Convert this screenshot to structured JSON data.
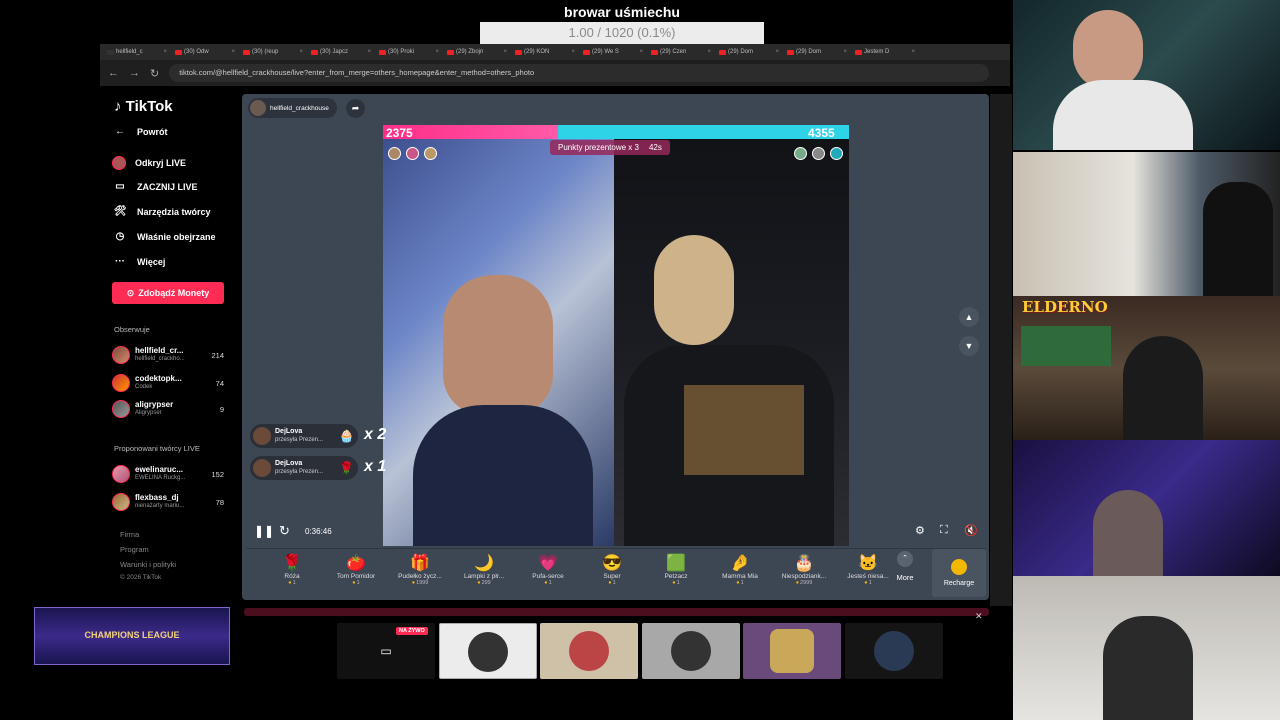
{
  "overlay": {
    "title": "browar uśmiechu",
    "progress_text": "1.00 / 1020 (0.1%)"
  },
  "browser": {
    "tabs": [
      "hellfield_c",
      "(30) Odw",
      "(30) (reup",
      "(30) Japcz",
      "(30) Proki",
      "(29) Zbojn",
      "(29) KON",
      "(29) We S",
      "(29) Czen",
      "(29) Dom",
      "(29) Dom",
      "Jestem D"
    ],
    "url": "tiktok.com/@hellfield_crackhouse/live?enter_from_merge=others_homepage&enter_method=others_photo"
  },
  "sidebar": {
    "logo": "TikTok",
    "back": "Powrót",
    "nav": [
      "Odkryj LIVE",
      "ZACZNIJ LIVE",
      "Narzędzia twórcy",
      "Właśnie obejrzane",
      "Więcej"
    ],
    "earn_button": "Zdobądź Monety",
    "following_title": "Obserwuje",
    "following": [
      {
        "name": "hellfield_cr...",
        "sub": "hellfield_crackho...",
        "count": "214"
      },
      {
        "name": "codektopk...",
        "sub": "Codek",
        "count": "74"
      },
      {
        "name": "aligrypser",
        "sub": "Aligrypser",
        "count": "9"
      }
    ],
    "suggested_title": "Proponowani twórcy LIVE",
    "suggested": [
      {
        "name": "ewelinaruc...",
        "sub": "EWELINA Ruckg...",
        "count": "152"
      },
      {
        "name": "flexbass_dj",
        "sub": "nienażarty mariu...",
        "count": "78"
      }
    ],
    "footer": [
      "Firma",
      "Program",
      "Warunki i polityki",
      "© 2026 TikTok"
    ]
  },
  "player": {
    "host": "hellfield_crackhouse",
    "score_left": "2375",
    "score_right": "4355",
    "battle_label": "Punkty prezentowe x 3",
    "battle_timer": "42s",
    "toasts": [
      {
        "user": "DejLova",
        "text": "przesyła Prezen...",
        "mult": "x 2"
      },
      {
        "user": "DejLova",
        "text": "przesyła Prezen...",
        "mult": "x 1"
      }
    ],
    "time": "0:36:46"
  },
  "gifts": [
    {
      "name": "Róża",
      "price": "1",
      "icon": "🌹"
    },
    {
      "name": "Tom Pomidor",
      "price": "1",
      "icon": "🍅"
    },
    {
      "name": "Pudełko życz...",
      "price": "1999",
      "icon": "🎁"
    },
    {
      "name": "Lampki z płr...",
      "price": "299",
      "icon": "🌙"
    },
    {
      "name": "Pufa-serce",
      "price": "1",
      "icon": "💗"
    },
    {
      "name": "Super",
      "price": "1",
      "icon": "😎"
    },
    {
      "name": "Petzacz",
      "price": "1",
      "icon": "🟩"
    },
    {
      "name": "Mamma Mia",
      "price": "1",
      "icon": "🤌"
    },
    {
      "name": "Niespodziank...",
      "price": "2999",
      "icon": "🎂"
    },
    {
      "name": "Jesteś niesa...",
      "price": "1",
      "icon": "🐱"
    }
  ],
  "more_label": "More",
  "recharge_label": "Recharge",
  "live_badge": "NA ŻYWO",
  "banner_text": "CHAMPIONS LEAGUE",
  "elder_label": "ELDERNO",
  "colors": {
    "tiktok_red": "#fe2c55",
    "battle_pink": "#ff2d88",
    "battle_cyan": "#2ed3e8",
    "player_bg": "#3d4754"
  }
}
